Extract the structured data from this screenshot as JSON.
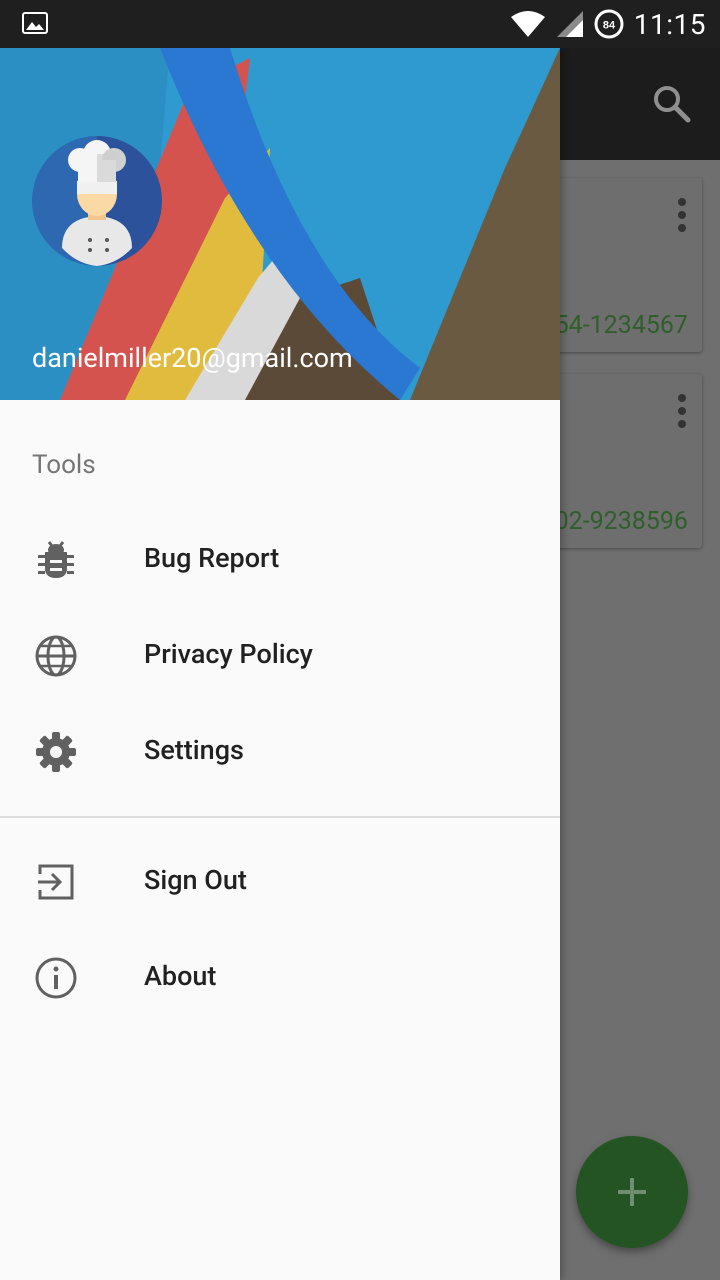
{
  "status_bar": {
    "time": "11:15",
    "battery": "84"
  },
  "background": {
    "card1_number": "54-1234567",
    "card2_number": "02-9238596"
  },
  "drawer": {
    "email": "danielmiller20@gmail.com",
    "section_title": "Tools",
    "items": [
      {
        "label": "Bug Report",
        "icon": "bug-icon"
      },
      {
        "label": "Privacy Policy",
        "icon": "globe-icon"
      },
      {
        "label": "Settings",
        "icon": "gear-icon"
      },
      {
        "label": "Sign Out",
        "icon": "sign-out-icon"
      },
      {
        "label": "About",
        "icon": "info-icon"
      }
    ]
  },
  "colors": {
    "accent_green": "#2e5f2a",
    "fab": "#245424",
    "icon_gray": "#616161"
  }
}
